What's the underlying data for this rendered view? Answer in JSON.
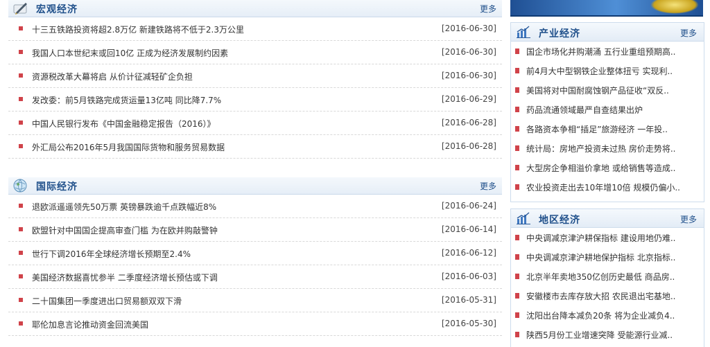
{
  "macro": {
    "title": "宏观经济",
    "more": "更多",
    "items": [
      {
        "title": "十三五铁路投资将超2.8万亿 新建铁路将不低于2.3万公里",
        "date": "[2016-06-30]"
      },
      {
        "title": "我国人口本世纪末或回10亿 正成为经济发展制约因素",
        "date": "[2016-06-30]"
      },
      {
        "title": "资源税改革大幕将启 从价计征减轻矿企负担",
        "date": "[2016-06-30]"
      },
      {
        "title": "发改委：前5月铁路完成货运量13亿吨 同比降7.7%",
        "date": "[2016-06-29]"
      },
      {
        "title": "中国人民银行发布《中国金融稳定报告（2016）》",
        "date": "[2016-06-28]"
      },
      {
        "title": "外汇局公布2016年5月我国国际货物和服务贸易数据",
        "date": "[2016-06-28]"
      }
    ]
  },
  "intl": {
    "title": "国际经济",
    "more": "更多",
    "items": [
      {
        "title": "退欧派遥遥领先50万票 英镑暴跌逾千点跌幅近8%",
        "date": "[2016-06-24]"
      },
      {
        "title": "欧盟针对中国国企提高审查门槛 为在欧并购敲警钟",
        "date": "[2016-06-14]"
      },
      {
        "title": "世行下调2016年全球经济增长预期至2.4%",
        "date": "[2016-06-12]"
      },
      {
        "title": "美国经济数据喜忧参半 二季度经济增长预估或下调",
        "date": "[2016-06-03]"
      },
      {
        "title": "二十国集团一季度进出口贸易额双双下滑",
        "date": "[2016-05-31]"
      },
      {
        "title": "耶伦加息言论推动资金回流美国",
        "date": "[2016-05-30]"
      }
    ]
  },
  "industry": {
    "title": "产业经济",
    "more": "更多",
    "items": [
      {
        "title": "国企市场化并购潮涌 五行业重组预期高.."
      },
      {
        "title": "前4月大中型钢铁企业整体扭亏 实现利.."
      },
      {
        "title": "美国将对中国耐腐蚀钢产品征收“双反.."
      },
      {
        "title": "药品流通领域最严自查结果出炉"
      },
      {
        "title": "各路资本争相“插足”旅游经济 一年投.."
      },
      {
        "title": "统计局：房地产投资未过热 房价走势将.."
      },
      {
        "title": "大型房企争相溢价拿地 或给销售等造成.."
      },
      {
        "title": "农业投资走出去10年增10倍 规模仍偏小.."
      }
    ]
  },
  "region": {
    "title": "地区经济",
    "more": "更多",
    "items": [
      {
        "title": "中央调减京津沪耕保指标 建设用地仍难.."
      },
      {
        "title": "中央调减京津沪耕地保护指标 北京指标.."
      },
      {
        "title": "北京半年卖地350亿创历史最低 商品房.."
      },
      {
        "title": "安徽楼市去库存放大招 农民退出宅基地.."
      },
      {
        "title": "沈阳出台降本减负20条 将为企业减负4.."
      },
      {
        "title": "陕西5月份工业增速突降 受能源行业减.."
      }
    ]
  },
  "icons": {
    "macro": "pen-icon",
    "intl": "globe-icon",
    "industry": "bar-chart-icon",
    "region": "bar-chart-icon",
    "bullet": "square-bullet-icon"
  },
  "colors": {
    "heading": "#1f4f8a",
    "bullet": "#d0434a",
    "header_bg": "#e6eef7"
  }
}
